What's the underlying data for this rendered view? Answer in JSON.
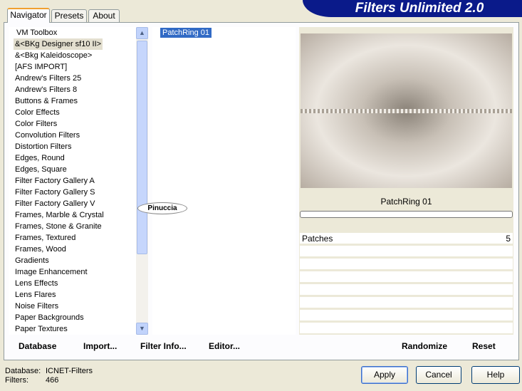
{
  "title": "Filters Unlimited 2.0",
  "tabs": [
    "Navigator",
    "Presets",
    "About"
  ],
  "categories": [
    "VM Toolbox",
    "&<BKg Designer sf10 II>",
    "&<Bkg Kaleidoscope>",
    "[AFS IMPORT]",
    "Andrew's Filters 25",
    "Andrew's Filters 8",
    "Buttons & Frames",
    "Color Effects",
    "Color Filters",
    "Convolution Filters",
    "Distortion Filters",
    "Edges, Round",
    "Edges, Square",
    "Filter Factory Gallery A",
    "Filter Factory Gallery S",
    "Filter Factory Gallery V",
    "Frames, Marble & Crystal",
    "Frames, Stone & Granite",
    "Frames, Textured",
    "Frames, Wood",
    "Gradients",
    "Image Enhancement",
    "Lens Effects",
    "Lens Flares",
    "Noise Filters",
    "Paper Backgrounds",
    "Paper Textures"
  ],
  "selected_category": "&<BKg Designer sf10 II>",
  "filters": [
    "PatchRing 01"
  ],
  "selected_filter_label": "PatchRing 01",
  "progress": 0,
  "params": [
    {
      "name": "Patches",
      "value": "5"
    }
  ],
  "bottom_buttons": {
    "database": "Database",
    "import": "Import...",
    "filter_info": "Filter Info...",
    "editor": "Editor...",
    "randomize": "Randomize",
    "reset": "Reset"
  },
  "status": {
    "database_label": "Database:",
    "database_value": "ICNET-Filters",
    "filters_label": "Filters:",
    "filters_value": "466"
  },
  "dialog_buttons": {
    "apply": "Apply",
    "cancel": "Cancel",
    "help": "Help"
  },
  "watermark": "Pinuccia"
}
